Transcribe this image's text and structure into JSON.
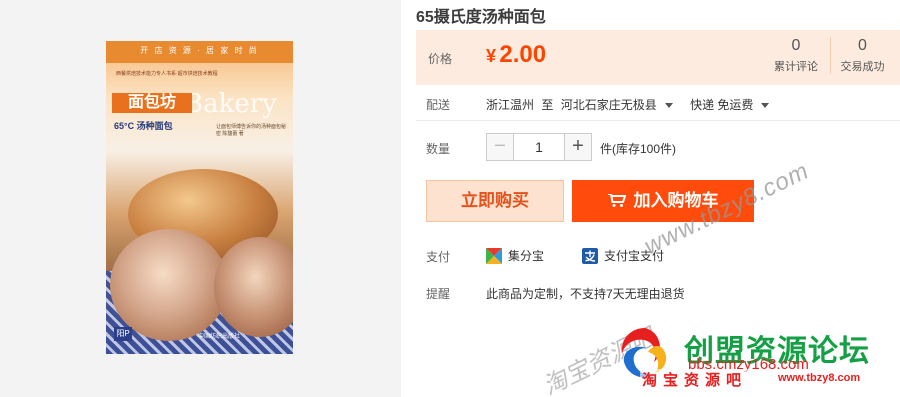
{
  "product": {
    "title": "65摄氏度汤种面包"
  },
  "cover": {
    "top_banner": "开 店 资 源 · 居 家 时 尚",
    "blurb": "西餐烘焙技术能力专人书系·超市烘焙技术教程",
    "title": "面包坊",
    "title_en": "Bakery",
    "subtitle": "65°C 汤种面包",
    "author": "让面包师傅告诉你的汤种面包秘密 陈馥蕾 著",
    "publisher_mark": "阳P",
    "publisher_name": "中国纺织出版社"
  },
  "price_panel": {
    "price_label": "价格",
    "currency": "¥",
    "price": "2.00",
    "stats": [
      {
        "count": "0",
        "label": "累计评论"
      },
      {
        "count": "0",
        "label": "交易成功"
      }
    ]
  },
  "shipping": {
    "label": "配送",
    "from": "浙江温州",
    "to_word": "至",
    "to": "河北石家庄无极县",
    "method": "快递 免运费"
  },
  "quantity": {
    "label": "数量",
    "minus": "−",
    "value": "1",
    "plus": "+",
    "stock": "件(库存100件)"
  },
  "actions": {
    "buy_now": "立即购买",
    "add_to_cart": "加入购物车"
  },
  "payment": {
    "label": "支付",
    "methods": [
      "集分宝",
      "支付宝支付"
    ]
  },
  "reminder": {
    "label": "提醒",
    "text": "此商品为定制，不支持7天无理由退货"
  },
  "watermark": {
    "diag_1": "www.tbzy8.com",
    "diag_2": "淘宝资源吧",
    "forum_name": "创盟资源论坛",
    "forum_url": "bbs.cmzy168.com",
    "slogan": "淘宝资源吧",
    "slogan_url": "www.tbzy8.com"
  },
  "colors": {
    "accent": "#ff4400",
    "price_bg": "#fdebdf",
    "buy_bg": "#fde3cf",
    "cart_bg": "#ff4c0c",
    "forum_green": "#15a046",
    "forum_red": "#e81f1f"
  },
  "icons": {
    "cart": "shopping-cart-icon",
    "jifenbao": "jifenbao-icon",
    "alipay": "alipay-icon",
    "caret": "chevron-down-icon"
  }
}
